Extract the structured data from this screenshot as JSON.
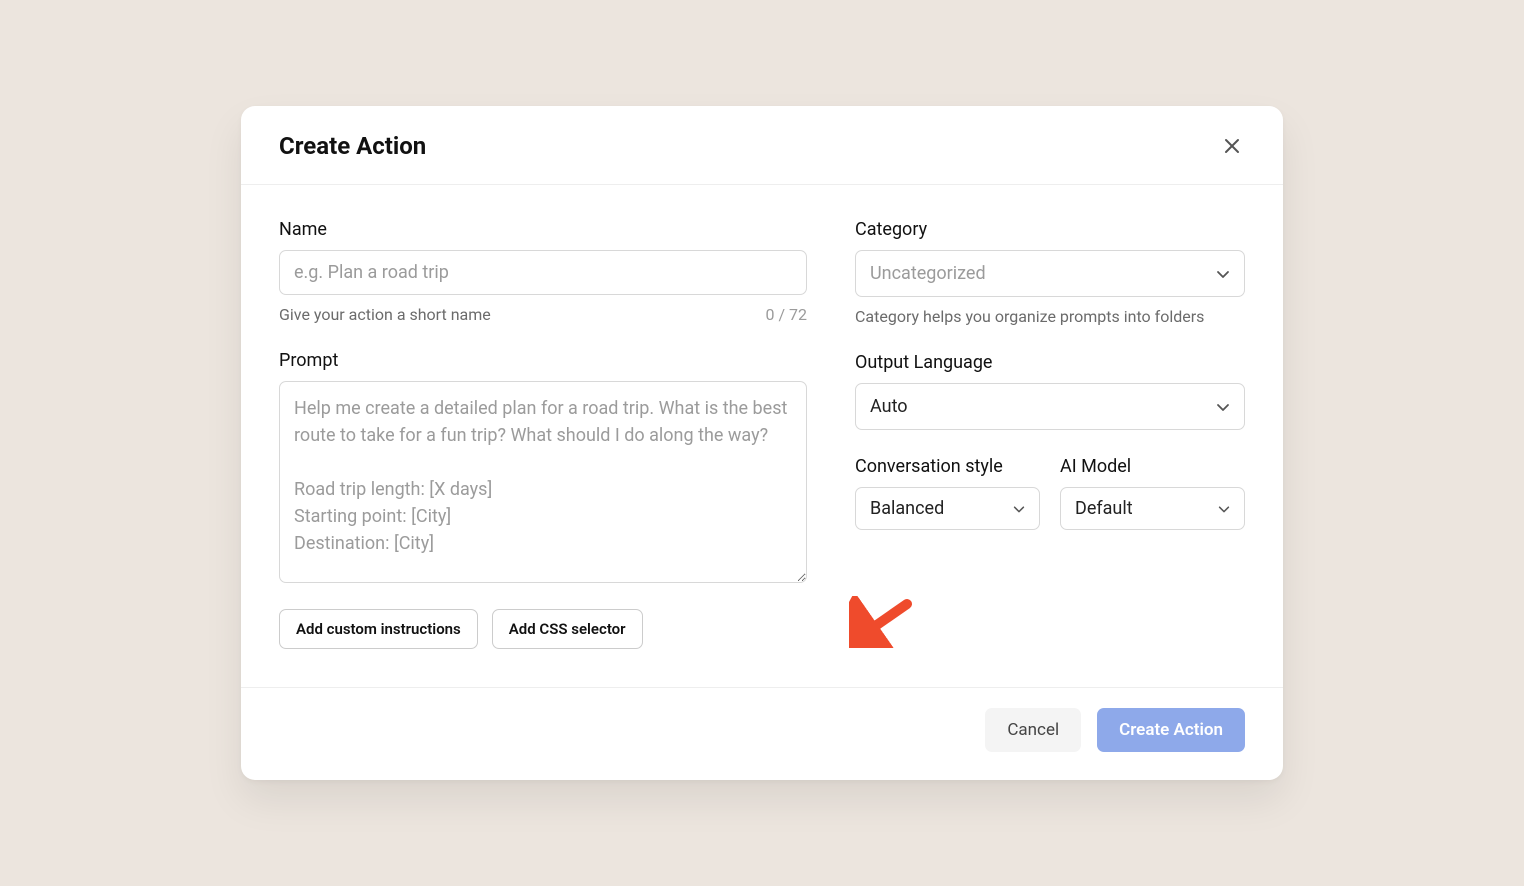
{
  "header": {
    "title": "Create Action"
  },
  "name_field": {
    "label": "Name",
    "placeholder": "e.g. Plan a road trip",
    "value": "",
    "helper": "Give your action a short name",
    "counter": "0 / 72"
  },
  "prompt_field": {
    "label": "Prompt",
    "placeholder": "Help me create a detailed plan for a road trip. What is the best route to take for a fun trip? What should I do along the way?\n\nRoad trip length: [X days]\nStarting point: [City]\nDestination: [City]",
    "value": ""
  },
  "buttons": {
    "add_custom": "Add custom instructions",
    "add_css": "Add CSS selector"
  },
  "category_field": {
    "label": "Category",
    "value": "Uncategorized",
    "helper": "Category helps you organize prompts into folders"
  },
  "output_lang": {
    "label": "Output Language",
    "value": "Auto"
  },
  "conv_style": {
    "label": "Conversation style",
    "value": "Balanced"
  },
  "ai_model": {
    "label": "AI Model",
    "value": "Default"
  },
  "footer": {
    "cancel": "Cancel",
    "create": "Create Action"
  }
}
